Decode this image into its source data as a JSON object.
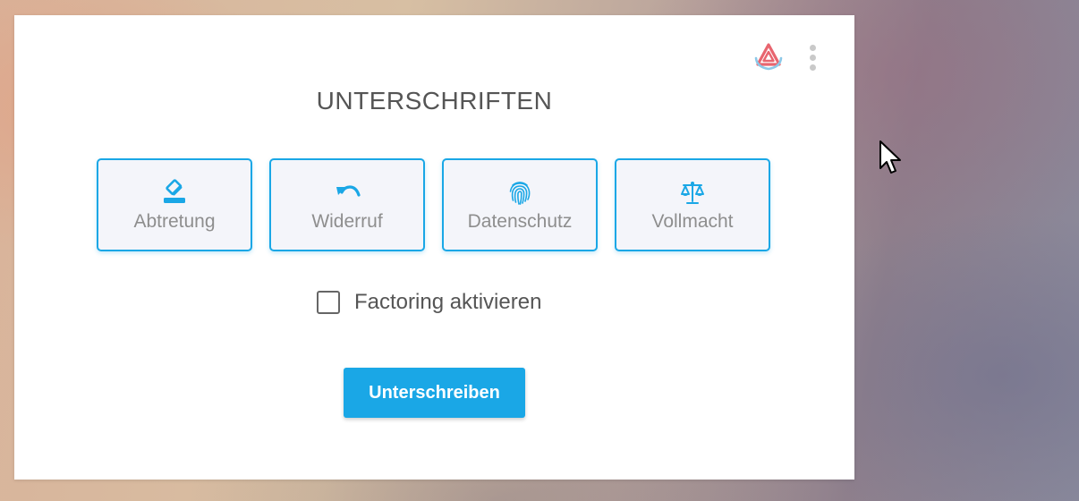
{
  "card": {
    "title": "UNTERSCHRIFTEN",
    "logo_icon": "brand-triangle-logo",
    "menu_icon": "more-vertical-icon"
  },
  "signature_types": [
    {
      "label": "Abtretung",
      "icon": "eraser-icon"
    },
    {
      "label": "Widerruf",
      "icon": "undo-icon"
    },
    {
      "label": "Datenschutz",
      "icon": "fingerprint-icon"
    },
    {
      "label": "Vollmacht",
      "icon": "balance-scale-icon"
    }
  ],
  "factoring": {
    "label": "Factoring aktivieren",
    "checked": false
  },
  "submit": {
    "label": "Unterschreiben"
  },
  "colors": {
    "accent": "#1aa7e6",
    "title_text": "#555555",
    "tile_label": "#8e8e8e",
    "tile_background": "#f4f5fa",
    "logo_red": "#e8656f",
    "logo_blue": "#8cc8e8"
  }
}
